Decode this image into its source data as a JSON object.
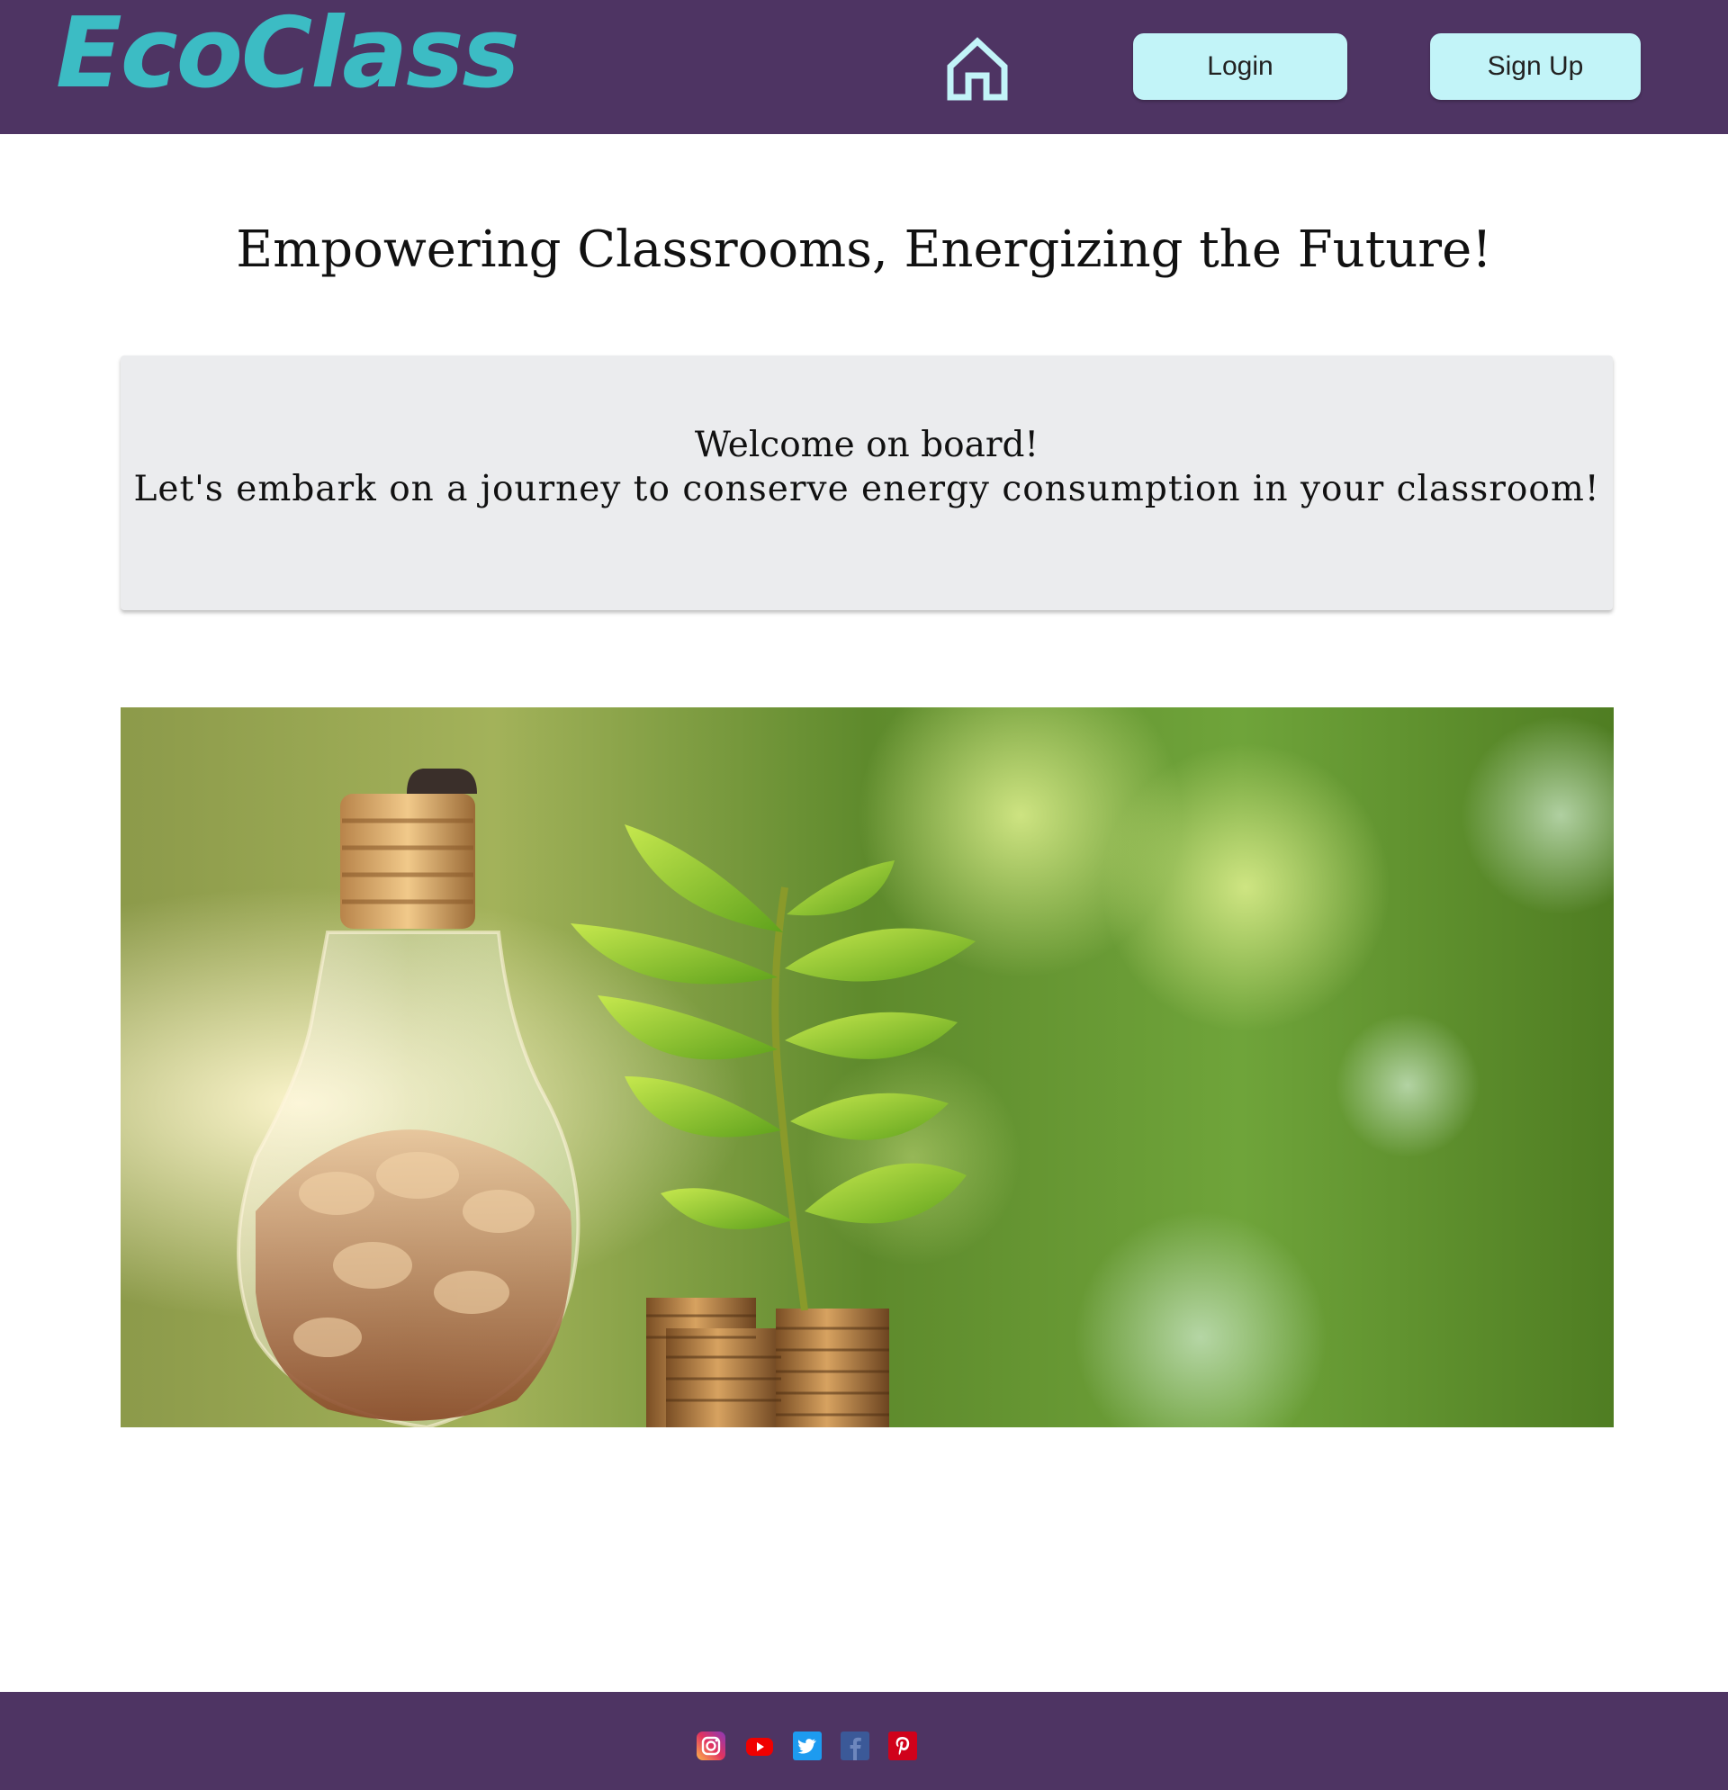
{
  "header": {
    "logo_text": "EcoClass",
    "home_icon": "home-icon",
    "login_label": "Login",
    "signup_label": "Sign Up"
  },
  "main": {
    "tagline": "Empowering Classrooms, Energizing the Future!",
    "welcome": {
      "line1": "Welcome on board!",
      "line2": "Let's embark on a journey to conserve energy consumption in your classroom!"
    },
    "hero_image": "lightbulb-with-coins-and-plant-photo"
  },
  "footer": {
    "social": [
      {
        "name": "instagram-icon"
      },
      {
        "name": "youtube-icon"
      },
      {
        "name": "twitter-icon"
      },
      {
        "name": "facebook-icon"
      },
      {
        "name": "pinterest-icon"
      }
    ]
  },
  "colors": {
    "brand_purple": "#4e3463",
    "logo_teal": "#3cbcc4",
    "button_bg": "#c2f4f8",
    "card_bg": "#ebecee"
  }
}
